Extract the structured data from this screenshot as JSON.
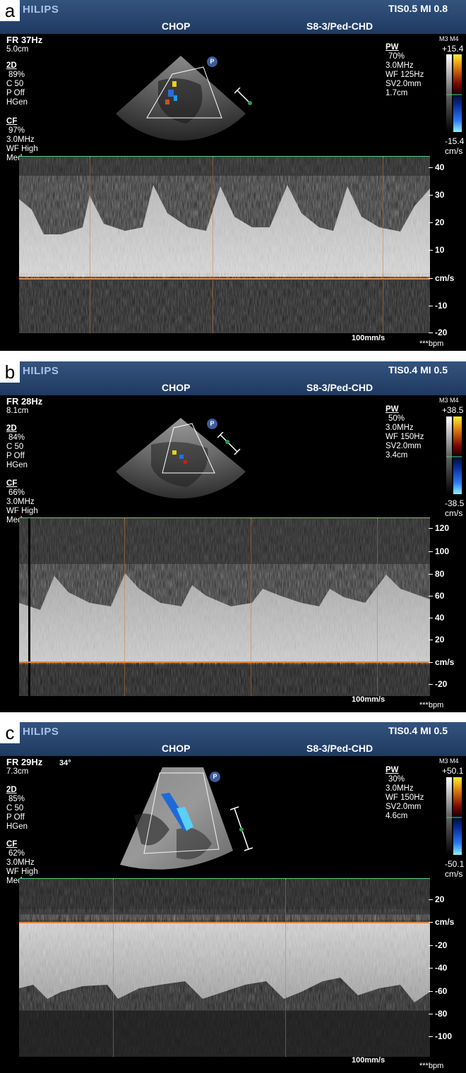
{
  "panels": [
    {
      "label": "a",
      "brand": "HILIPS",
      "tis_mi": "TIS0.5   MI 0.8",
      "site": "CHOP",
      "probe": "S8-3/Ped-CHD",
      "fr": "FR 37Hz",
      "depth": "5.0cm",
      "left_params": [
        "2D",
        "89%",
        "C 50",
        "P Off",
        "HGen",
        "CF",
        "97%",
        "3.0MHz",
        "WF High",
        "Med"
      ],
      "pw_title": "PW",
      "pw_params": [
        "70%",
        "3.0MHz",
        "WF 125Hz",
        "SV2.0mm",
        "1.7cm"
      ],
      "scale_header": "M3 M4",
      "scale_max": "+15.4",
      "scale_min": "-15.4",
      "scale_unit": "cm/s",
      "ticks": [
        "40",
        "30",
        "20",
        "10",
        "cm/s",
        "-10",
        "-20"
      ],
      "sweep": "100mm/s",
      "bpm": "***bpm",
      "p_badge": "P"
    },
    {
      "label": "b",
      "brand": "HILIPS",
      "tis_mi": "TIS0.4   MI 0.5",
      "site": "CHOP",
      "probe": "S8-3/Ped-CHD",
      "fr": "FR 28Hz",
      "depth": "8.1cm",
      "left_params": [
        "2D",
        "84%",
        "C 50",
        "P Off",
        "HGen",
        "CF",
        "66%",
        "3.0MHz",
        "WF High",
        "Med"
      ],
      "pw_title": "PW",
      "pw_params": [
        "50%",
        "3.0MHz",
        "WF 150Hz",
        "SV2.0mm",
        "3.4cm"
      ],
      "scale_header": "M3 M4",
      "scale_max": "+38.5",
      "scale_min": "-38.5",
      "scale_unit": "cm/s",
      "ticks": [
        "120",
        "100",
        "80",
        "60",
        "40",
        "20",
        "cm/s",
        "-20"
      ],
      "sweep": "100mm/s",
      "bpm": "***bpm",
      "p_badge": "P"
    },
    {
      "label": "c",
      "brand": "HILIPS",
      "tis_mi": "TIS0.4   MI 0.5",
      "site": "CHOP",
      "probe": "S8-3/Ped-CHD",
      "fr": "FR 29Hz",
      "angle": "34°",
      "depth": "7.3cm",
      "left_params": [
        "2D",
        "85%",
        "C 50",
        "P Off",
        "HGen",
        "CF",
        "62%",
        "3.0MHz",
        "WF High",
        "Med"
      ],
      "pw_title": "PW",
      "pw_params": [
        "30%",
        "3.0MHz",
        "WF 150Hz",
        "SV2.0mm",
        "4.6cm"
      ],
      "scale_header": "M3 M4",
      "scale_max": "+50.1",
      "scale_min": "-50.1",
      "scale_unit": "cm/s",
      "ticks": [
        "20",
        "cm/s",
        "-20",
        "-40",
        "-60",
        "-80",
        "-100"
      ],
      "sweep": "100mm/s",
      "bpm": "***bpm",
      "p_badge": "P"
    }
  ]
}
